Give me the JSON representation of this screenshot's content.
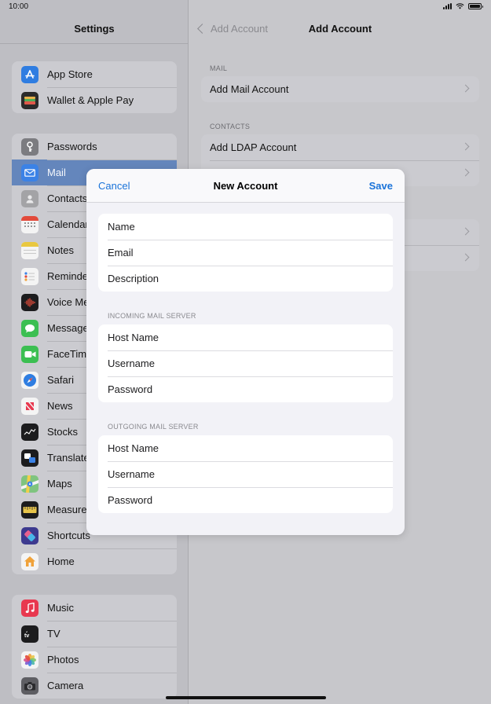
{
  "status_bar": {
    "time": "10:00"
  },
  "sidebar": {
    "title": "Settings",
    "groups": [
      {
        "items": [
          {
            "label": "App Store",
            "icon": "app-store-icon",
            "color": "#2f7de1"
          },
          {
            "label": "Wallet & Apple Pay",
            "icon": "wallet-icon",
            "color": "#2b2b2b"
          }
        ]
      },
      {
        "items": [
          {
            "label": "Passwords",
            "icon": "key-icon",
            "color": "#7c7c80"
          },
          {
            "label": "Mail",
            "icon": "mail-icon",
            "color": "#3b82e6",
            "selected": true
          },
          {
            "label": "Contacts",
            "icon": "contacts-icon",
            "color": "#9b9b9b"
          },
          {
            "label": "Calendar",
            "icon": "calendar-icon",
            "color": "#e24a3b"
          },
          {
            "label": "Notes",
            "icon": "notes-icon",
            "color": "#e9c840"
          },
          {
            "label": "Reminders",
            "icon": "reminders-icon",
            "color": "#f2f2f2"
          },
          {
            "label": "Voice Memos",
            "icon": "voice-memos-icon",
            "color": "#1c1c1e"
          },
          {
            "label": "Messages",
            "icon": "messages-icon",
            "color": "#3cbf52"
          },
          {
            "label": "FaceTime",
            "icon": "facetime-icon",
            "color": "#3cbf52"
          },
          {
            "label": "Safari",
            "icon": "safari-icon",
            "color": "#2f7de1"
          },
          {
            "label": "News",
            "icon": "news-icon",
            "color": "#f2f2f2"
          },
          {
            "label": "Stocks",
            "icon": "stocks-icon",
            "color": "#1c1c1e"
          },
          {
            "label": "Translate",
            "icon": "translate-icon",
            "color": "#1c1c1e"
          },
          {
            "label": "Maps",
            "icon": "maps-icon",
            "color": "#58b56a"
          },
          {
            "label": "Measure",
            "icon": "measure-icon",
            "color": "#1c1c1e"
          },
          {
            "label": "Shortcuts",
            "icon": "shortcuts-icon",
            "color": "#5b4bcf"
          },
          {
            "label": "Home",
            "icon": "home-icon",
            "color": "#f2f2f2"
          }
        ]
      },
      {
        "items": [
          {
            "label": "Music",
            "icon": "music-icon",
            "color": "#e8384f"
          },
          {
            "label": "TV",
            "icon": "tv-icon",
            "color": "#1c1c1e"
          },
          {
            "label": "Photos",
            "icon": "photos-icon",
            "color": "#f2f2f2"
          },
          {
            "label": "Camera",
            "icon": "camera-icon",
            "color": "#5e5e63"
          }
        ]
      }
    ]
  },
  "detail": {
    "back_label": "Add Account",
    "title": "Add Account",
    "mail_section": "MAIL",
    "mail_rows": [
      "Add Mail Account"
    ],
    "contacts_section": "CONTACTS",
    "contacts_rows": [
      "Add LDAP Account",
      ""
    ]
  },
  "modal": {
    "cancel_label": "Cancel",
    "title": "New Account",
    "save_label": "Save",
    "account_fields": [
      {
        "placeholder": "Name",
        "value": ""
      },
      {
        "placeholder": "Email",
        "value": ""
      },
      {
        "placeholder": "Description",
        "value": ""
      }
    ],
    "incoming_section": "INCOMING MAIL SERVER",
    "incoming_fields": [
      {
        "placeholder": "Host Name",
        "value": ""
      },
      {
        "placeholder": "Username",
        "value": ""
      },
      {
        "placeholder": "Password",
        "value": ""
      }
    ],
    "outgoing_section": "OUTGOING MAIL SERVER",
    "outgoing_fields": [
      {
        "placeholder": "Host Name",
        "value": ""
      },
      {
        "placeholder": "Username",
        "value": ""
      },
      {
        "placeholder": "Password",
        "value": ""
      }
    ]
  }
}
